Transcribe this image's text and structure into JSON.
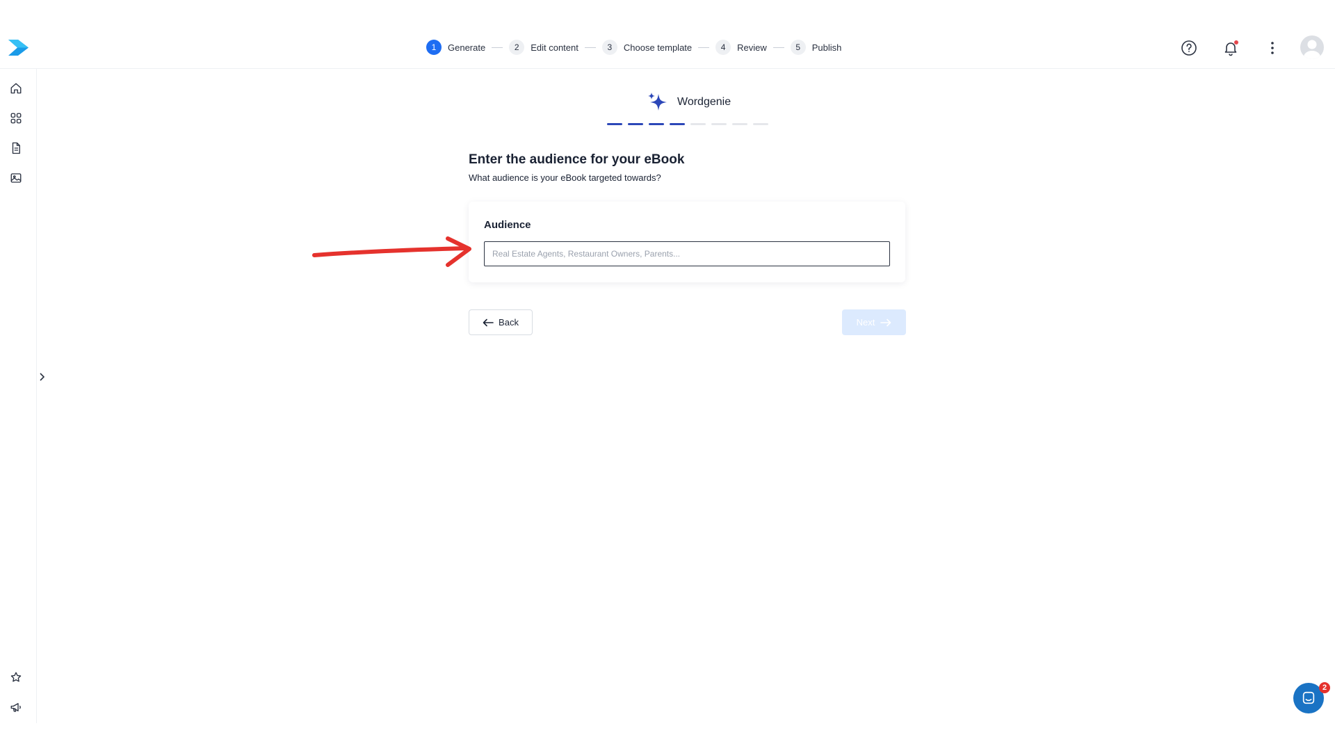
{
  "stepper": {
    "steps": [
      {
        "num": "1",
        "label": "Generate",
        "active": true
      },
      {
        "num": "2",
        "label": "Edit content",
        "active": false
      },
      {
        "num": "3",
        "label": "Choose template",
        "active": false
      },
      {
        "num": "4",
        "label": "Review",
        "active": false
      },
      {
        "num": "5",
        "label": "Publish",
        "active": false
      }
    ]
  },
  "brand": {
    "name": "Wordgenie"
  },
  "progress": {
    "completed_segments": 4,
    "total_segments": 8
  },
  "page": {
    "heading": "Enter the audience for your eBook",
    "subheading": "What audience is your eBook targeted towards?"
  },
  "form": {
    "audience_label": "Audience",
    "audience_value": "",
    "audience_placeholder": "Real Estate Agents, Restaurant Owners, Parents..."
  },
  "actions": {
    "back_label": "Back",
    "next_label": "Next"
  },
  "chat": {
    "unread_count": "2"
  },
  "colors": {
    "accent": "#1e6df2",
    "progress_done": "#2c47b8",
    "next_disabled_bg": "#dceafe",
    "annotation_arrow": "#e5322d",
    "chat_launcher": "#1a73c4"
  },
  "icons": {
    "logo": "app-logo-chevron",
    "help": "help-circle-icon",
    "notifications": "bell-icon",
    "more": "more-vertical-icon",
    "sidebar": [
      "home-icon",
      "grid-icon",
      "document-icon",
      "image-icon",
      "star-icon",
      "megaphone-icon"
    ],
    "brand": "sparkle-icon"
  }
}
